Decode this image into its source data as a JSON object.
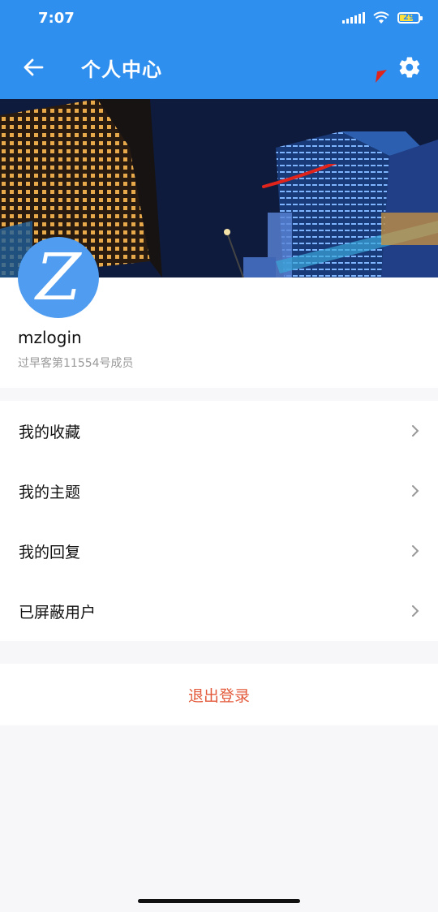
{
  "status_bar": {
    "time": "7:07",
    "battery": "29"
  },
  "header": {
    "title": "个人中心"
  },
  "icons": {
    "back": "arrow-left-icon",
    "settings": "gear-icon",
    "chevron": "chevron-right-icon"
  },
  "profile": {
    "avatar_letter": "Z",
    "username": "mzlogin",
    "member_text": "过早客第11554号成员"
  },
  "menu": {
    "items": [
      {
        "label": "我的收藏"
      },
      {
        "label": "我的主题"
      },
      {
        "label": "我的回复"
      },
      {
        "label": "已屏蔽用户"
      }
    ]
  },
  "logout": {
    "label": "退出登录"
  },
  "colors": {
    "header_bg": "#2f8fef",
    "logout_text": "#e35b3c",
    "annotation_arrow": "#e0241c"
  }
}
